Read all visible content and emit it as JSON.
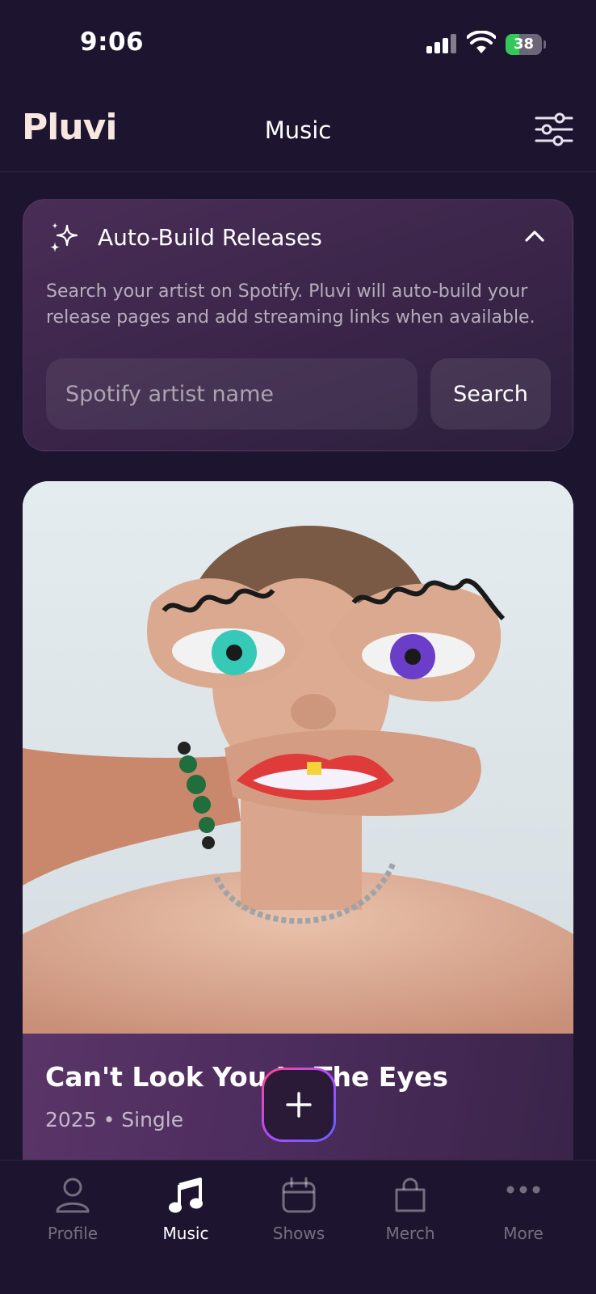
{
  "status_bar": {
    "time": "9:06",
    "battery_level": "38",
    "battery_fraction": 0.38
  },
  "header": {
    "logo": "Pluvi",
    "title": "Music",
    "settings_icon": "sliders-icon"
  },
  "auto_build": {
    "title": "Auto-Build Releases",
    "icon": "sparkles-icon",
    "collapse_icon": "chevron-up-icon",
    "description": "Search your artist on Spotify. Pluvi will auto-build your release pages and add streaming links when available.",
    "input_placeholder": "Spotify artist name",
    "input_value": "",
    "search_label": "Search"
  },
  "release": {
    "title": "Can't Look You In The Eyes",
    "meta": "2025 • Single"
  },
  "fab": {
    "icon": "plus-icon"
  },
  "nav": {
    "items": [
      {
        "label": "Profile",
        "icon": "person-icon",
        "active": false
      },
      {
        "label": "Music",
        "icon": "music-note-icon",
        "active": true
      },
      {
        "label": "Shows",
        "icon": "calendar-icon",
        "active": false
      },
      {
        "label": "Merch",
        "icon": "shopping-bag-icon",
        "active": false
      },
      {
        "label": "More",
        "icon": "more-dots-icon",
        "active": false
      }
    ]
  },
  "colors": {
    "background": "#1d1530",
    "card": "#3a2548",
    "battery_green": "#34c759",
    "logo": "#f7e7df"
  }
}
